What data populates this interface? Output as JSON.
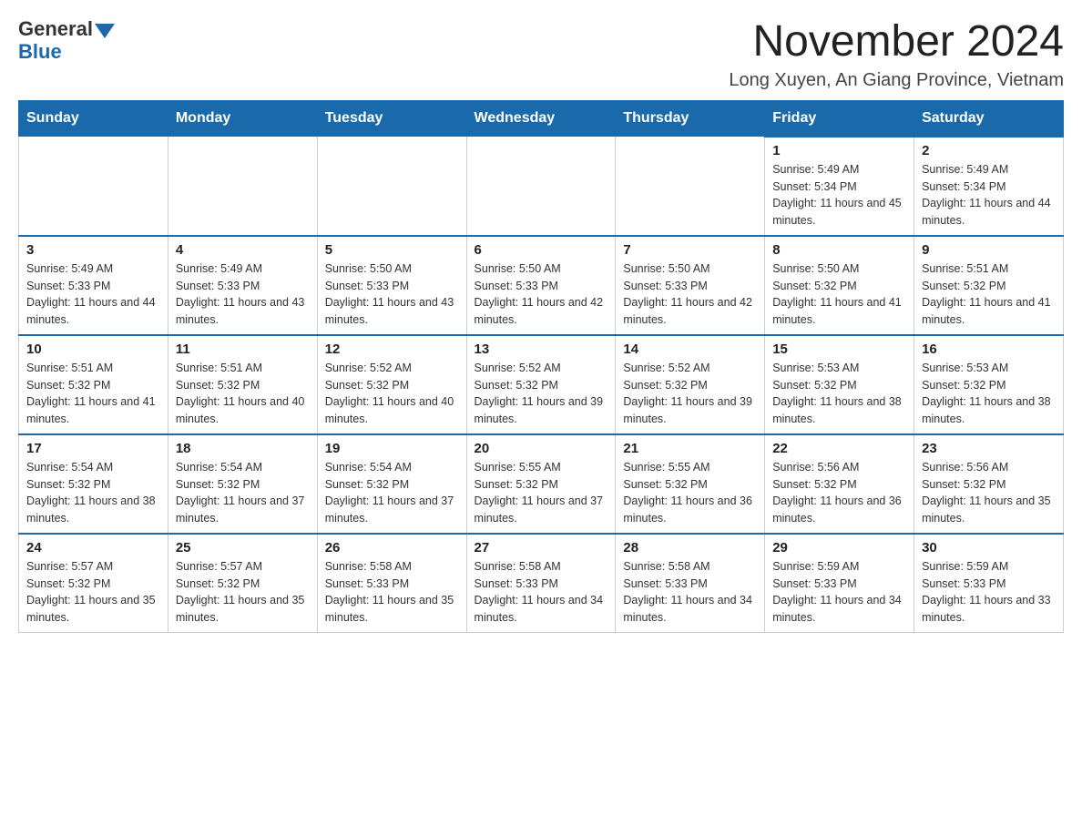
{
  "logo": {
    "general": "General",
    "blue": "Blue",
    "tagline": "Blue"
  },
  "header": {
    "month": "November 2024",
    "location": "Long Xuyen, An Giang Province, Vietnam"
  },
  "days_of_week": [
    "Sunday",
    "Monday",
    "Tuesday",
    "Wednesday",
    "Thursday",
    "Friday",
    "Saturday"
  ],
  "weeks": [
    [
      {
        "day": "",
        "sunrise": "",
        "sunset": "",
        "daylight": ""
      },
      {
        "day": "",
        "sunrise": "",
        "sunset": "",
        "daylight": ""
      },
      {
        "day": "",
        "sunrise": "",
        "sunset": "",
        "daylight": ""
      },
      {
        "day": "",
        "sunrise": "",
        "sunset": "",
        "daylight": ""
      },
      {
        "day": "",
        "sunrise": "",
        "sunset": "",
        "daylight": ""
      },
      {
        "day": "1",
        "sunrise": "Sunrise: 5:49 AM",
        "sunset": "Sunset: 5:34 PM",
        "daylight": "Daylight: 11 hours and 45 minutes."
      },
      {
        "day": "2",
        "sunrise": "Sunrise: 5:49 AM",
        "sunset": "Sunset: 5:34 PM",
        "daylight": "Daylight: 11 hours and 44 minutes."
      }
    ],
    [
      {
        "day": "3",
        "sunrise": "Sunrise: 5:49 AM",
        "sunset": "Sunset: 5:33 PM",
        "daylight": "Daylight: 11 hours and 44 minutes."
      },
      {
        "day": "4",
        "sunrise": "Sunrise: 5:49 AM",
        "sunset": "Sunset: 5:33 PM",
        "daylight": "Daylight: 11 hours and 43 minutes."
      },
      {
        "day": "5",
        "sunrise": "Sunrise: 5:50 AM",
        "sunset": "Sunset: 5:33 PM",
        "daylight": "Daylight: 11 hours and 43 minutes."
      },
      {
        "day": "6",
        "sunrise": "Sunrise: 5:50 AM",
        "sunset": "Sunset: 5:33 PM",
        "daylight": "Daylight: 11 hours and 42 minutes."
      },
      {
        "day": "7",
        "sunrise": "Sunrise: 5:50 AM",
        "sunset": "Sunset: 5:33 PM",
        "daylight": "Daylight: 11 hours and 42 minutes."
      },
      {
        "day": "8",
        "sunrise": "Sunrise: 5:50 AM",
        "sunset": "Sunset: 5:32 PM",
        "daylight": "Daylight: 11 hours and 41 minutes."
      },
      {
        "day": "9",
        "sunrise": "Sunrise: 5:51 AM",
        "sunset": "Sunset: 5:32 PM",
        "daylight": "Daylight: 11 hours and 41 minutes."
      }
    ],
    [
      {
        "day": "10",
        "sunrise": "Sunrise: 5:51 AM",
        "sunset": "Sunset: 5:32 PM",
        "daylight": "Daylight: 11 hours and 41 minutes."
      },
      {
        "day": "11",
        "sunrise": "Sunrise: 5:51 AM",
        "sunset": "Sunset: 5:32 PM",
        "daylight": "Daylight: 11 hours and 40 minutes."
      },
      {
        "day": "12",
        "sunrise": "Sunrise: 5:52 AM",
        "sunset": "Sunset: 5:32 PM",
        "daylight": "Daylight: 11 hours and 40 minutes."
      },
      {
        "day": "13",
        "sunrise": "Sunrise: 5:52 AM",
        "sunset": "Sunset: 5:32 PM",
        "daylight": "Daylight: 11 hours and 39 minutes."
      },
      {
        "day": "14",
        "sunrise": "Sunrise: 5:52 AM",
        "sunset": "Sunset: 5:32 PM",
        "daylight": "Daylight: 11 hours and 39 minutes."
      },
      {
        "day": "15",
        "sunrise": "Sunrise: 5:53 AM",
        "sunset": "Sunset: 5:32 PM",
        "daylight": "Daylight: 11 hours and 38 minutes."
      },
      {
        "day": "16",
        "sunrise": "Sunrise: 5:53 AM",
        "sunset": "Sunset: 5:32 PM",
        "daylight": "Daylight: 11 hours and 38 minutes."
      }
    ],
    [
      {
        "day": "17",
        "sunrise": "Sunrise: 5:54 AM",
        "sunset": "Sunset: 5:32 PM",
        "daylight": "Daylight: 11 hours and 38 minutes."
      },
      {
        "day": "18",
        "sunrise": "Sunrise: 5:54 AM",
        "sunset": "Sunset: 5:32 PM",
        "daylight": "Daylight: 11 hours and 37 minutes."
      },
      {
        "day": "19",
        "sunrise": "Sunrise: 5:54 AM",
        "sunset": "Sunset: 5:32 PM",
        "daylight": "Daylight: 11 hours and 37 minutes."
      },
      {
        "day": "20",
        "sunrise": "Sunrise: 5:55 AM",
        "sunset": "Sunset: 5:32 PM",
        "daylight": "Daylight: 11 hours and 37 minutes."
      },
      {
        "day": "21",
        "sunrise": "Sunrise: 5:55 AM",
        "sunset": "Sunset: 5:32 PM",
        "daylight": "Daylight: 11 hours and 36 minutes."
      },
      {
        "day": "22",
        "sunrise": "Sunrise: 5:56 AM",
        "sunset": "Sunset: 5:32 PM",
        "daylight": "Daylight: 11 hours and 36 minutes."
      },
      {
        "day": "23",
        "sunrise": "Sunrise: 5:56 AM",
        "sunset": "Sunset: 5:32 PM",
        "daylight": "Daylight: 11 hours and 35 minutes."
      }
    ],
    [
      {
        "day": "24",
        "sunrise": "Sunrise: 5:57 AM",
        "sunset": "Sunset: 5:32 PM",
        "daylight": "Daylight: 11 hours and 35 minutes."
      },
      {
        "day": "25",
        "sunrise": "Sunrise: 5:57 AM",
        "sunset": "Sunset: 5:32 PM",
        "daylight": "Daylight: 11 hours and 35 minutes."
      },
      {
        "day": "26",
        "sunrise": "Sunrise: 5:58 AM",
        "sunset": "Sunset: 5:33 PM",
        "daylight": "Daylight: 11 hours and 35 minutes."
      },
      {
        "day": "27",
        "sunrise": "Sunrise: 5:58 AM",
        "sunset": "Sunset: 5:33 PM",
        "daylight": "Daylight: 11 hours and 34 minutes."
      },
      {
        "day": "28",
        "sunrise": "Sunrise: 5:58 AM",
        "sunset": "Sunset: 5:33 PM",
        "daylight": "Daylight: 11 hours and 34 minutes."
      },
      {
        "day": "29",
        "sunrise": "Sunrise: 5:59 AM",
        "sunset": "Sunset: 5:33 PM",
        "daylight": "Daylight: 11 hours and 34 minutes."
      },
      {
        "day": "30",
        "sunrise": "Sunrise: 5:59 AM",
        "sunset": "Sunset: 5:33 PM",
        "daylight": "Daylight: 11 hours and 33 minutes."
      }
    ]
  ]
}
